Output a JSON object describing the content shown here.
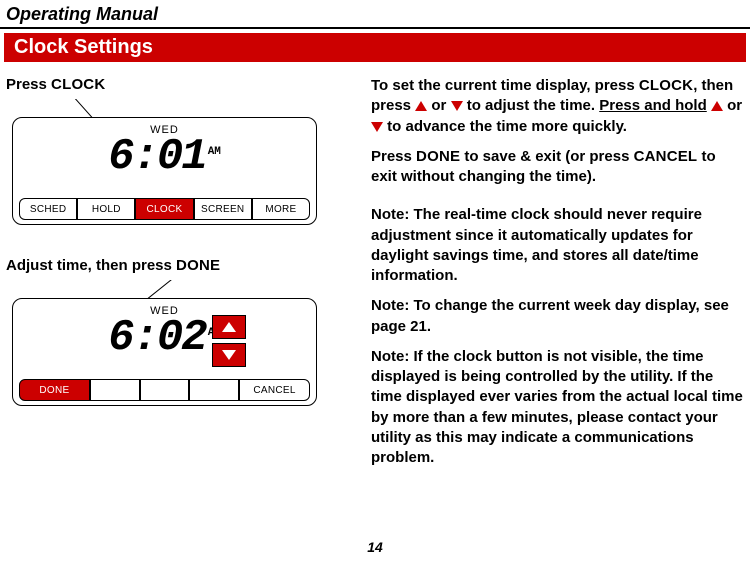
{
  "header": {
    "manual_title": "Operating Manual"
  },
  "section": {
    "title": "Clock Settings"
  },
  "left": {
    "step1_prefix": "Press ",
    "step1_button": "CLOCK",
    "step2_prefix": "Adjust time, then press ",
    "step2_button": "DONE"
  },
  "device1": {
    "day": "WED",
    "time": "6:01",
    "ampm": "AM",
    "buttons": [
      "SCHED",
      "HOLD",
      "CLOCK",
      "SCREEN",
      "MORE"
    ]
  },
  "device2": {
    "day": "WED",
    "time": "6:02",
    "ampm": "AM",
    "done": "DONE",
    "cancel": "CANCEL"
  },
  "right": {
    "p1a": "To set the current time display, press ",
    "p1_clock": "CLOCK",
    "p1b": ", then press ",
    "p1c": " or ",
    "p1d": " to adjust the time. ",
    "p1_hold": "Press and hold",
    "p1e": " ",
    "p1f": " or ",
    "p1g": " to advance the time more quickly.",
    "p2a": "Press ",
    "p2_done": "DONE",
    "p2b": " to save & exit (or press ",
    "p2_cancel": "CANCEL",
    "p2c": " to exit without changing the time).",
    "note_label": "Note:",
    "n1": " The real-time clock should never require adjustment since it automatically updates for daylight savings time, and stores all date/time information.",
    "n2": " To change the current week day display, see page 21.",
    "n3": " If the clock button is not visible, the time displayed is being controlled by the utility. If the time displayed ever varies from the actual local time by more than a few minutes, please contact your utility as this may indicate a communications problem."
  },
  "page": "14"
}
